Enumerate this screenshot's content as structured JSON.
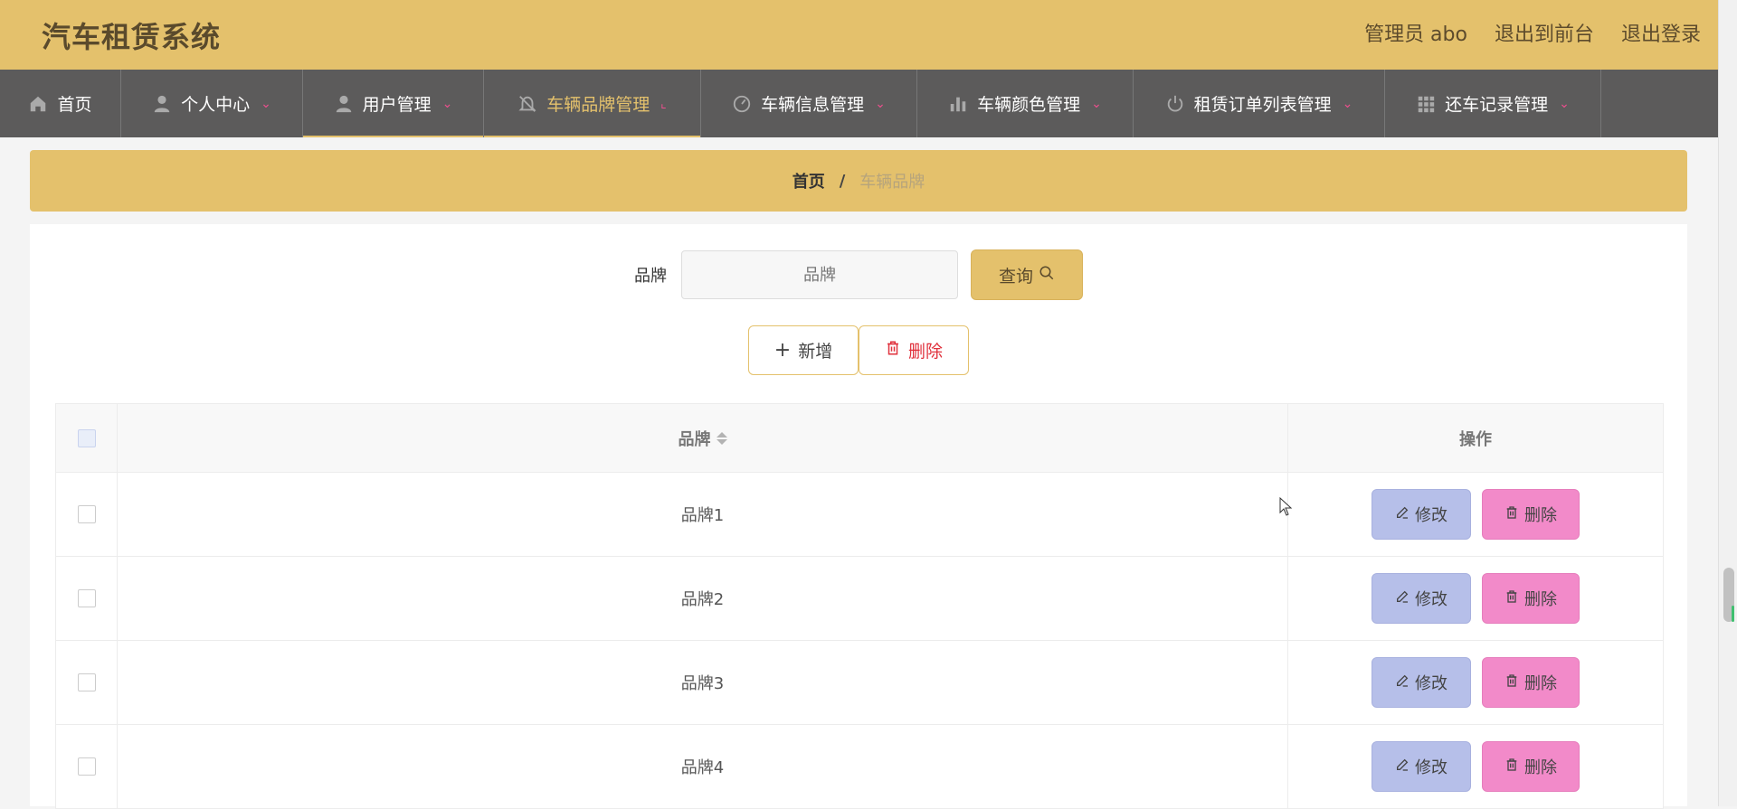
{
  "header": {
    "title": "汽车租赁系统",
    "admin": "管理员 abo",
    "to_front": "退出到前台",
    "logout": "退出登录"
  },
  "nav": [
    {
      "label": "首页",
      "icon": "home-icon"
    },
    {
      "label": "个人中心",
      "icon": "user-icon"
    },
    {
      "label": "用户管理",
      "icon": "user-icon"
    },
    {
      "label": "车辆品牌管理",
      "icon": "bell-off-icon"
    },
    {
      "label": "车辆信息管理",
      "icon": "gauge-icon"
    },
    {
      "label": "车辆颜色管理",
      "icon": "bar-chart-icon"
    },
    {
      "label": "租赁订单列表管理",
      "icon": "power-icon"
    },
    {
      "label": "还车记录管理",
      "icon": "grid-icon"
    }
  ],
  "breadcrumb": {
    "home": "首页",
    "sep": "/",
    "current": "车辆品牌"
  },
  "search": {
    "label": "品牌",
    "placeholder": "品牌",
    "button": "查询"
  },
  "actions": {
    "add": "新增",
    "delete": "删除"
  },
  "table": {
    "columns": [
      "品牌",
      "操作"
    ],
    "rows": [
      {
        "brand": "品牌1"
      },
      {
        "brand": "品牌2"
      },
      {
        "brand": "品牌3"
      },
      {
        "brand": "品牌4"
      }
    ],
    "edit_label": "修改",
    "delete_label": "删除"
  },
  "colors": {
    "primary": "#e4c16c",
    "nav_bg": "#5c5b5b",
    "edit_btn": "#b6bfe9",
    "delete_btn": "#f28ac9"
  }
}
